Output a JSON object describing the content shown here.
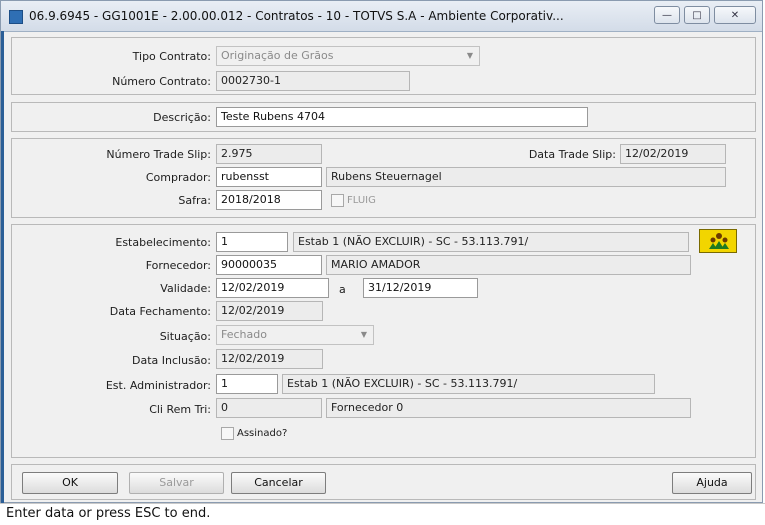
{
  "window": {
    "title": "06.9.6945 - GG1001E - 2.00.00.012 - Contratos - 10 - TOTVS S.A - Ambiente Corporativ...",
    "minimize_glyph": "—",
    "maximize_glyph": "□",
    "close_glyph": "✕"
  },
  "section1": {
    "tipo_contrato_label": "Tipo Contrato:",
    "tipo_contrato_value": "Originação de Grãos",
    "numero_contrato_label": "Número Contrato:",
    "numero_contrato_value": "0002730-1"
  },
  "section2": {
    "descricao_label": "Descrição:",
    "descricao_value": "Teste Rubens 4704"
  },
  "section3": {
    "numero_trade_slip_label": "Número Trade Slip:",
    "numero_trade_slip_value": "2.975",
    "data_trade_slip_label": "Data Trade Slip:",
    "data_trade_slip_value": "12/02/2019",
    "comprador_label": "Comprador:",
    "comprador_code": "rubensst",
    "comprador_name": "Rubens Steuernagel",
    "safra_label": "Safra:",
    "safra_value": "2018/2018",
    "fluig_label": "FLUIG"
  },
  "section4": {
    "estabelecimento_label": "Estabelecimento:",
    "estabelecimento_code": "1",
    "estabelecimento_name": "Estab 1 (NÃO EXCLUIR) - SC - 53.113.791/",
    "fornecedor_label": "Fornecedor:",
    "fornecedor_code": "90000035",
    "fornecedor_name": "MARIO AMADOR",
    "validade_label": "Validade:",
    "validade_start": "12/02/2019",
    "validade_sep": "a",
    "validade_end": "31/12/2019",
    "data_fechamento_label": "Data Fechamento:",
    "data_fechamento_value": "12/02/2019",
    "situacao_label": "Situação:",
    "situacao_value": "Fechado",
    "data_inclusao_label": "Data Inclusão:",
    "data_inclusao_value": "12/02/2019",
    "est_admin_label": "Est. Administrador:",
    "est_admin_code": "1",
    "est_admin_name": "Estab 1 (NÃO EXCLUIR) - SC - 53.113.791/",
    "cli_rem_tri_label": "Cli Rem Tri:",
    "cli_rem_tri_code": "0",
    "cli_rem_tri_name": "Fornecedor 0",
    "assinado_label": "Assinado?"
  },
  "buttons": {
    "ok": "OK",
    "salvar": "Salvar",
    "cancelar": "Cancelar",
    "ajuda": "Ajuda"
  },
  "status": {
    "text": "Enter data or press ESC to end."
  },
  "colors": {
    "zoom_button_bg": "#f2d500",
    "side_strip": "#2b5f97"
  }
}
